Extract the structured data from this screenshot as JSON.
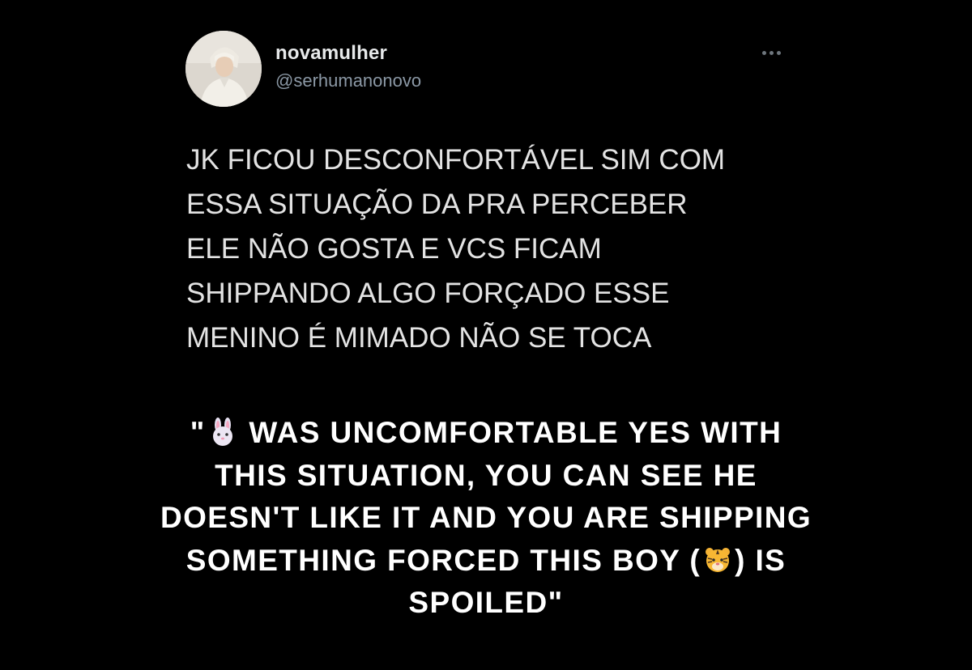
{
  "tweet": {
    "display_name": "novamulher",
    "handle": "@serhumanonovo",
    "avatar_icon": "profile-photo",
    "more_icon": "more-horizontal-icon",
    "text_lines": [
      "JK FICOU DESCONFORTÁVEL SIM COM",
      "ESSA SITUAÇÃO DA PRA PERCEBER",
      "ELE NÃO GOSTA E VCS FICAM",
      "SHIPPANDO ALGO FORÇADO ESSE",
      "MENINO É MIMADO NÃO SE TOCA"
    ]
  },
  "caption": {
    "line1_open_quote": "\"",
    "line1_emoji": "rabbit-face-emoji",
    "line1_rest": " WAS UNCOMFORTABLE YES WITH",
    "line2": "THIS SITUATION, YOU CAN SEE HE",
    "line3": "DOESN'T LIKE IT AND YOU ARE SHIPPING",
    "line4_start": "SOMETHING FORCED THIS BOY (",
    "line4_emoji": "tiger-face-emoji",
    "line4_end": ") IS",
    "line5": "SPOILED\""
  },
  "colors": {
    "background": "#000000",
    "name": "#e7e9ea",
    "handle": "#8b98a5",
    "tweet_text": "#e3e3e3",
    "caption_text": "#ffffff"
  }
}
